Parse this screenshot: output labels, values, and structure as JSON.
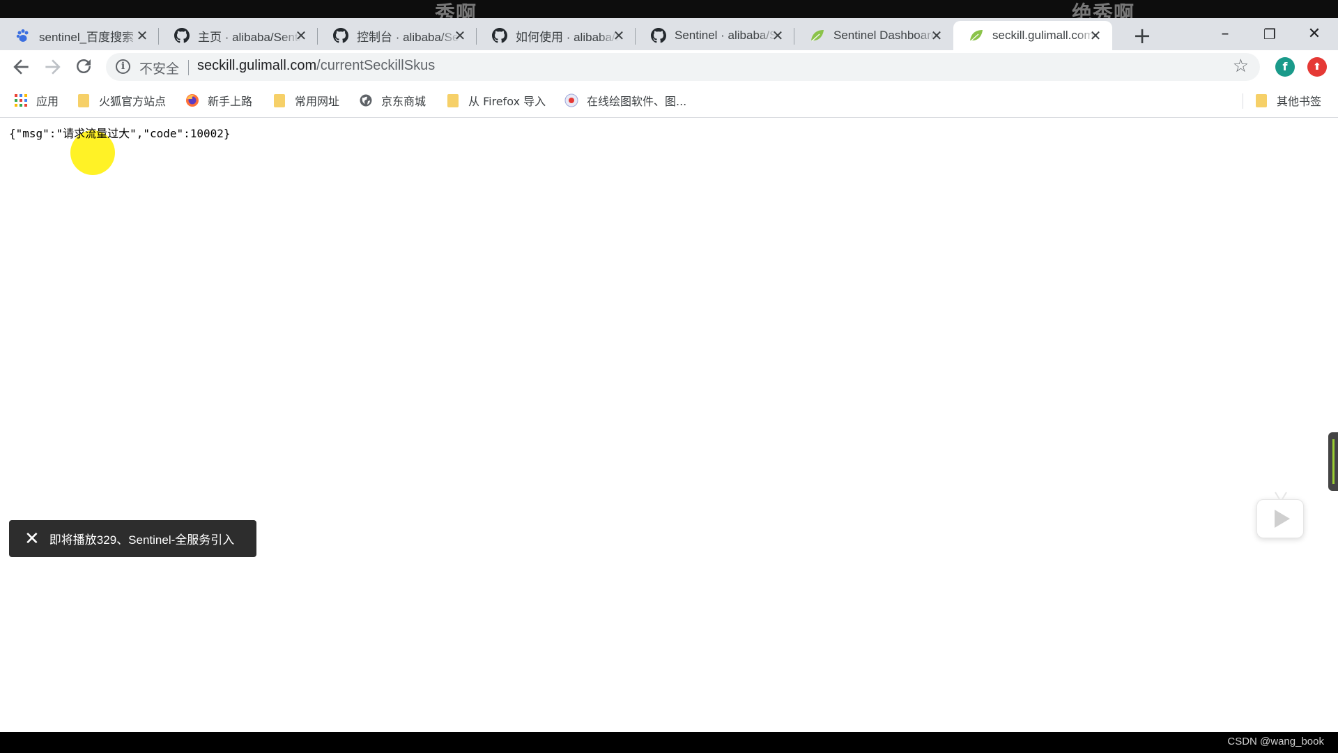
{
  "overlay": {
    "danmaku": [
      "秀啊",
      "绝秀啊"
    ]
  },
  "tabs": [
    {
      "title": "sentinel_百度搜索",
      "icon": "baidu-paw-icon"
    },
    {
      "title": "主页 · alibaba/Sentinel",
      "icon": "github-icon"
    },
    {
      "title": "控制台 · alibaba/Sentinel",
      "icon": "github-icon"
    },
    {
      "title": "如何使用 · alibaba/Sentinel",
      "icon": "github-icon"
    },
    {
      "title": "Sentinel · alibaba/Sentinel",
      "icon": "github-icon"
    },
    {
      "title": "Sentinel Dashboard",
      "icon": "spring-leaf-icon"
    },
    {
      "title": "seckill.gulimall.com",
      "icon": "spring-leaf-icon",
      "active": true
    }
  ],
  "tab_close_glyph": "✕",
  "new_tab_glyph": "+",
  "window_controls": {
    "minimize": "–",
    "restore": "❐",
    "close": "✕"
  },
  "toolbar": {
    "security_label": "不安全",
    "url_host": "seckill.gulimall.com",
    "url_path": "/currentSeckillSkus",
    "extensions": [
      {
        "label": "f",
        "color": "#1a9a8a"
      },
      {
        "label": "⬆",
        "color": "#e53935"
      }
    ]
  },
  "bookmarks": {
    "items": [
      {
        "label": "应用",
        "icon": "apps-grid-icon"
      },
      {
        "label": "火狐官方站点",
        "icon": "folder-icon"
      },
      {
        "label": "新手上路",
        "icon": "firefox-icon"
      },
      {
        "label": "常用网址",
        "icon": "folder-icon"
      },
      {
        "label": "京东商城",
        "icon": "globe-icon"
      },
      {
        "label": "从 Firefox 导入",
        "icon": "folder-icon"
      },
      {
        "label": "在线绘图软件、图...",
        "icon": "drawing-app-icon"
      }
    ],
    "other": {
      "label": "其他书签",
      "icon": "folder-icon"
    }
  },
  "page": {
    "json_text": "{\"msg\":\"请求流量过大\",\"code\":10002}"
  },
  "toast": {
    "text": "即将播放329、Sentinel-全服务引入"
  },
  "footer": {
    "watermark": "CSDN @wang_book"
  },
  "colors": {
    "apps_grid": [
      "#ea4335",
      "#4285f4",
      "#fbbc05",
      "#34a853",
      "#ea4335",
      "#4285f4",
      "#fbbc05",
      "#34a853",
      "#ea4335"
    ]
  }
}
